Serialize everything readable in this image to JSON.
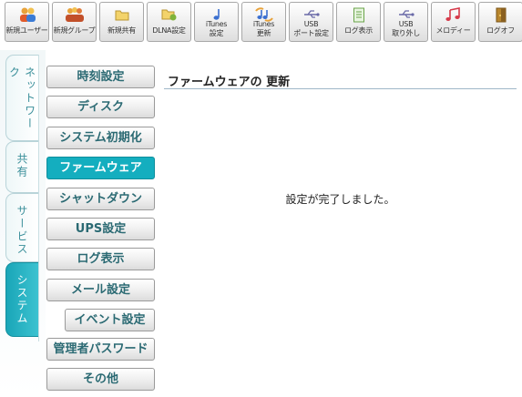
{
  "toolbar": {
    "items": [
      {
        "label": "新規ユーザー",
        "icon": "users-icon"
      },
      {
        "label": "新規グループ",
        "icon": "group-icon"
      },
      {
        "label": "新規共有",
        "icon": "folder-icon"
      },
      {
        "label": "DLNA設定",
        "icon": "dlna-icon"
      },
      {
        "label": "iTunes\n設定",
        "icon": "itunes-note-icon"
      },
      {
        "label": "iTunes\n更新",
        "icon": "itunes-update-icon"
      },
      {
        "label": "USB\nポート設定",
        "icon": "usb-icon"
      },
      {
        "label": "ログ表示",
        "icon": "log-document-icon"
      },
      {
        "label": "USB\n取り外し",
        "icon": "usb-remove-icon"
      },
      {
        "label": "メロディー",
        "icon": "melody-icon"
      },
      {
        "label": "ログオフ",
        "icon": "door-exit-icon"
      }
    ]
  },
  "tabs": [
    {
      "label": "ネットワーク",
      "active": false
    },
    {
      "label": "共有",
      "active": false
    },
    {
      "label": "サービス",
      "active": false
    },
    {
      "label": "システム",
      "active": true
    }
  ],
  "menu": {
    "items": [
      {
        "label": "時刻設定"
      },
      {
        "label": "ディスク"
      },
      {
        "label": "システム初期化"
      },
      {
        "label": "ファームウェア",
        "active": true
      },
      {
        "label": "シャットダウン"
      },
      {
        "label": "UPS設定"
      },
      {
        "label": "ログ表示"
      },
      {
        "label": "メール設定"
      },
      {
        "label": "イベント設定"
      },
      {
        "label": "管理者パスワード"
      },
      {
        "label": "その他"
      }
    ]
  },
  "content": {
    "title": "ファームウェアの 更新",
    "message": "設定が完了しました。"
  },
  "colors": {
    "accent": "#14aebf",
    "tab_text": "#3a8f9a",
    "menu_text": "#2b6a73"
  }
}
